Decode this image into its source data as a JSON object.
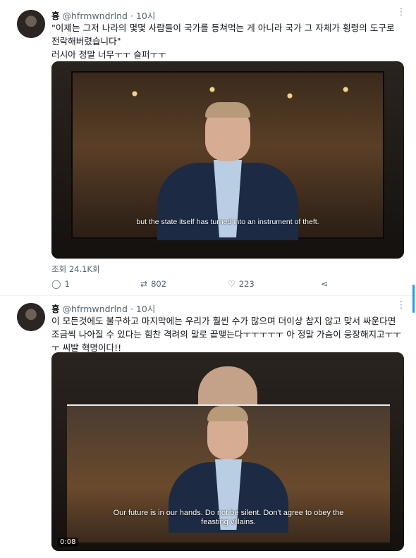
{
  "tweets": [
    {
      "name": "흉",
      "handle": "@hfrmwndrlnd",
      "dot": "·",
      "time": "10시",
      "text": "\"이제는 그저 나라의 몇몇 사람들이 국가를 등쳐먹는 게 아니라 국가 그 자체가 횡령의 도구로 전락해버렸습니다\"\n러시아 정말 너무ㅜㅜ 슬퍼ㅜㅜ",
      "subtitle": "but the state itself has turned into an instrument of theft.",
      "views": "조회 24.1K회",
      "reply_count": "1",
      "retweet_count": "802",
      "like_count": "223"
    },
    {
      "name": "흉",
      "handle": "@hfrmwndrlnd",
      "dot": "·",
      "time": "10시",
      "text": "이 모든것에도 불구하고 마지막에는 우리가 훨씬 수가 많으며 더이상 참지 않고 맞서 싸운다면 조금씩 나아질 수 있다는 힘찬 격려의 말로 끝맺는다ㅜㅜㅜㅜㅜ 아 정말 가슴이 웅장해지고ㅜㅜㅜ 씨발 혁명이다!!",
      "subtitle": "Our future is in our hands. Do not be silent. Don't agree to obey the feasting villains.",
      "timecode": "0:08"
    }
  ],
  "icons": {
    "more": "more-dots-icon",
    "reply": "reply-icon",
    "retweet": "retweet-icon",
    "like": "heart-icon",
    "share": "share-icon"
  },
  "colors": {
    "text": "#0f1419",
    "muted": "#536471",
    "accent": "#1d9bf0"
  }
}
